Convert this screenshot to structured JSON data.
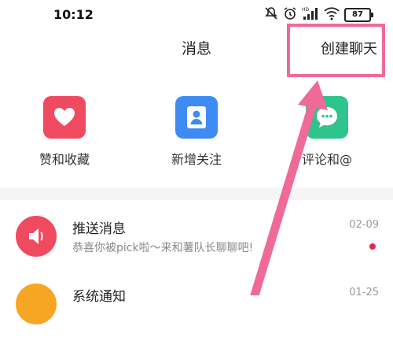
{
  "status_bar": {
    "time": "10:12",
    "battery": "87",
    "hd_label": "HD",
    "icons": [
      "mute-icon",
      "alarm-icon",
      "signal-icon",
      "wifi-icon",
      "battery-icon"
    ]
  },
  "header": {
    "title": "消息",
    "create_chat_label": "创建聊天"
  },
  "quick_actions": [
    {
      "label": "赞和收藏",
      "icon": "heart-icon",
      "color": "#ef4a60"
    },
    {
      "label": "新增关注",
      "icon": "person-icon",
      "color": "#3d8bf3"
    },
    {
      "label": "评论和@",
      "icon": "chat-bubble-icon",
      "color": "#2ec48c"
    }
  ],
  "messages": [
    {
      "title": "推送消息",
      "subtitle": "恭喜你被pick啦～来和薯队长聊聊吧!",
      "time": "02-09",
      "unread": true,
      "avatar_color": "#ef4a60",
      "icon": "speaker-icon"
    },
    {
      "title": "系统通知",
      "subtitle": "",
      "time": "01-25",
      "unread": false,
      "avatar_color": "#f6a623",
      "icon": "bell-icon"
    }
  ],
  "colors": {
    "highlight": "#f06a99",
    "unread_dot": "#e02947"
  }
}
